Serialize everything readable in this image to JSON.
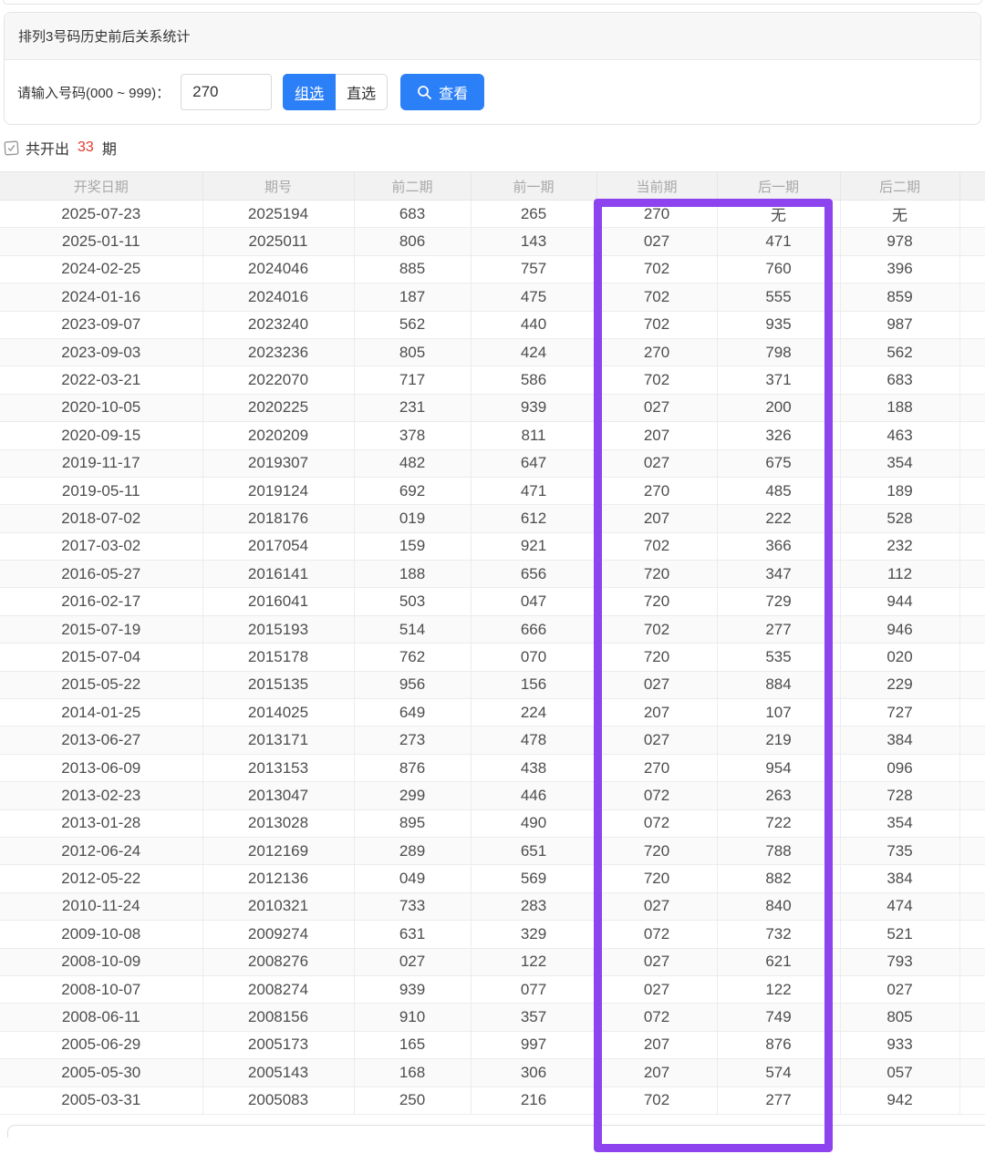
{
  "panel": {
    "title": "排列3号码历史前后关系统计",
    "input_label": "请输入号码(000 ~ 999)：",
    "input_value": "270",
    "group_button_label": "组选",
    "direct_button_label": "直选",
    "view_button_label": "查看"
  },
  "summary": {
    "prefix": "共开出",
    "count": "33",
    "suffix": "期"
  },
  "colors": {
    "accent_blue": "#2b7ff7",
    "count_red": "#e23b30",
    "highlight_purple": "#8d43ee"
  },
  "table": {
    "headers": [
      "开奖日期",
      "期号",
      "前二期",
      "前一期",
      "当前期",
      "后一期",
      "后二期"
    ],
    "highlighted_columns": [
      "当前期",
      "后一期"
    ],
    "rows": [
      [
        "2025-07-23",
        "2025194",
        "683",
        "265",
        "270",
        "无",
        "无"
      ],
      [
        "2025-01-11",
        "2025011",
        "806",
        "143",
        "027",
        "471",
        "978"
      ],
      [
        "2024-02-25",
        "2024046",
        "885",
        "757",
        "702",
        "760",
        "396"
      ],
      [
        "2024-01-16",
        "2024016",
        "187",
        "475",
        "702",
        "555",
        "859"
      ],
      [
        "2023-09-07",
        "2023240",
        "562",
        "440",
        "702",
        "935",
        "987"
      ],
      [
        "2023-09-03",
        "2023236",
        "805",
        "424",
        "270",
        "798",
        "562"
      ],
      [
        "2022-03-21",
        "2022070",
        "717",
        "586",
        "702",
        "371",
        "683"
      ],
      [
        "2020-10-05",
        "2020225",
        "231",
        "939",
        "027",
        "200",
        "188"
      ],
      [
        "2020-09-15",
        "2020209",
        "378",
        "811",
        "207",
        "326",
        "463"
      ],
      [
        "2019-11-17",
        "2019307",
        "482",
        "647",
        "027",
        "675",
        "354"
      ],
      [
        "2019-05-11",
        "2019124",
        "692",
        "471",
        "270",
        "485",
        "189"
      ],
      [
        "2018-07-02",
        "2018176",
        "019",
        "612",
        "207",
        "222",
        "528"
      ],
      [
        "2017-03-02",
        "2017054",
        "159",
        "921",
        "702",
        "366",
        "232"
      ],
      [
        "2016-05-27",
        "2016141",
        "188",
        "656",
        "720",
        "347",
        "112"
      ],
      [
        "2016-02-17",
        "2016041",
        "503",
        "047",
        "720",
        "729",
        "944"
      ],
      [
        "2015-07-19",
        "2015193",
        "514",
        "666",
        "702",
        "277",
        "946"
      ],
      [
        "2015-07-04",
        "2015178",
        "762",
        "070",
        "720",
        "535",
        "020"
      ],
      [
        "2015-05-22",
        "2015135",
        "956",
        "156",
        "027",
        "884",
        "229"
      ],
      [
        "2014-01-25",
        "2014025",
        "649",
        "224",
        "207",
        "107",
        "727"
      ],
      [
        "2013-06-27",
        "2013171",
        "273",
        "478",
        "027",
        "219",
        "384"
      ],
      [
        "2013-06-09",
        "2013153",
        "876",
        "438",
        "270",
        "954",
        "096"
      ],
      [
        "2013-02-23",
        "2013047",
        "299",
        "446",
        "072",
        "263",
        "728"
      ],
      [
        "2013-01-28",
        "2013028",
        "895",
        "490",
        "072",
        "722",
        "354"
      ],
      [
        "2012-06-24",
        "2012169",
        "289",
        "651",
        "720",
        "788",
        "735"
      ],
      [
        "2012-05-22",
        "2012136",
        "049",
        "569",
        "720",
        "882",
        "384"
      ],
      [
        "2010-11-24",
        "2010321",
        "733",
        "283",
        "027",
        "840",
        "474"
      ],
      [
        "2009-10-08",
        "2009274",
        "631",
        "329",
        "072",
        "732",
        "521"
      ],
      [
        "2008-10-09",
        "2008276",
        "027",
        "122",
        "027",
        "621",
        "793"
      ],
      [
        "2008-10-07",
        "2008274",
        "939",
        "077",
        "027",
        "122",
        "027"
      ],
      [
        "2008-06-11",
        "2008156",
        "910",
        "357",
        "072",
        "749",
        "805"
      ],
      [
        "2005-06-29",
        "2005173",
        "165",
        "997",
        "207",
        "876",
        "933"
      ],
      [
        "2005-05-30",
        "2005143",
        "168",
        "306",
        "207",
        "574",
        "057"
      ],
      [
        "2005-03-31",
        "2005083",
        "250",
        "216",
        "702",
        "277",
        "942"
      ]
    ]
  }
}
